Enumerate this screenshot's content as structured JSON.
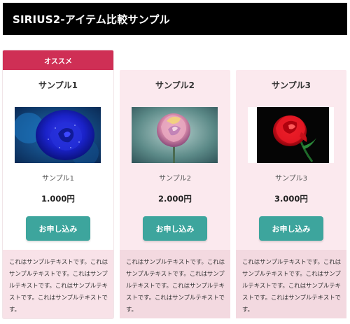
{
  "header": {
    "title": "SIRIUS2-アイテム比較サンプル"
  },
  "badge": {
    "label": "オススメ"
  },
  "products": [
    {
      "title": "サンプル1",
      "image": "blue-rose-photo",
      "caption": "サンプル1",
      "price": "1.000円",
      "button_label": "お申し込み",
      "description": "これはサンプルテキストです。これはサンプルテキストです。これはサンプルテキストです。これはサンプルテキストです。これはサンプルテキストです。"
    },
    {
      "title": "サンプル2",
      "image": "pink-rose-photo",
      "caption": "サンプル2",
      "price": "2.000円",
      "button_label": "お申し込み",
      "description": "これはサンプルテキストです。これはサンプルテキストです。これはサンプルテキストです。これはサンプルテキストです。これはサンプルテキストです。"
    },
    {
      "title": "サンプル3",
      "image": "red-rose-photo",
      "caption": "サンプル3",
      "price": "3.000円",
      "button_label": "お申し込み",
      "description": "これはサンプルテキストです。これはサンプルテキストです。これはサンプルテキストです。これはサンプルテキストです。これはサンプルテキストです。"
    }
  ],
  "colors": {
    "header_bg": "#000000",
    "badge_bg": "#cf2f55",
    "button_bg": "#3da59d",
    "card_bg": "#fbe9ee"
  }
}
